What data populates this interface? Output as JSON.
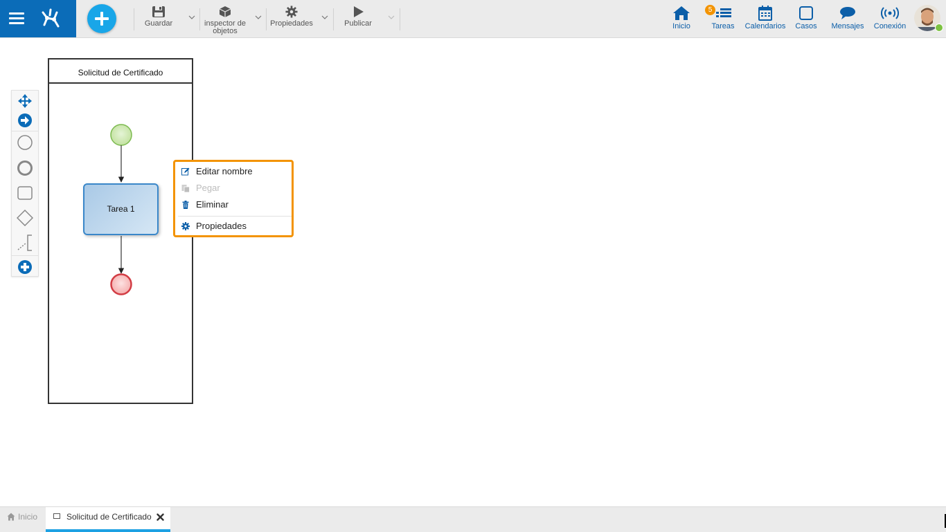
{
  "toolbar": {
    "save_label": "Guardar",
    "inspector_label_line1": "inspector de",
    "inspector_label_line2": "objetos",
    "properties_label": "Propiedades",
    "publish_label": "Publicar"
  },
  "nav": {
    "home_label": "Inicio",
    "tasks_label": "Tareas",
    "tasks_badge": "5",
    "calendars_label": "Calendarios",
    "cases_label": "Casos",
    "messages_label": "Mensajes",
    "connection_label": "Conexión"
  },
  "diagram": {
    "pool_title": "Solicitud de Certificado",
    "task_label": "Tarea 1"
  },
  "context_menu": {
    "items": [
      {
        "label": "Editar nombre",
        "icon": "edit-icon",
        "enabled": true
      },
      {
        "label": "Pegar",
        "icon": "paste-icon",
        "enabled": false
      },
      {
        "label": "Eliminar",
        "icon": "trash-icon",
        "enabled": true
      },
      {
        "label": "Propiedades",
        "icon": "gear-icon",
        "enabled": true
      }
    ]
  },
  "tabs": {
    "home_label": "Inicio",
    "active_label": "Solicitud de Certificado"
  },
  "colors": {
    "brand_blue": "#0b6cb8",
    "add_button": "#19a6e8",
    "menu_highlight": "#f39300",
    "start_event": "#c9e7a9",
    "end_event": "#f7b6b6",
    "active_tab_bar": "#1da1e3"
  }
}
